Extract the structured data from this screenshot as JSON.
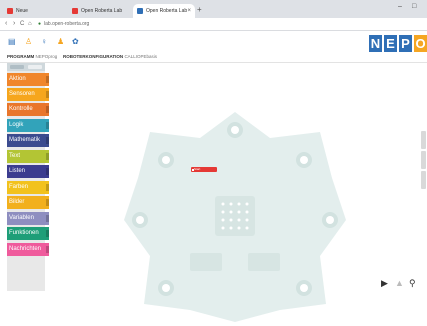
{
  "browser": {
    "tabs": [
      {
        "label": "Neue",
        "active": false
      },
      {
        "label": "Open Roberta Lab",
        "active": false
      },
      {
        "label": "Open Roberta Lab",
        "active": true
      }
    ],
    "new_tab": "+",
    "window_controls": [
      "–",
      "□"
    ],
    "nav": {
      "back": "‹",
      "forward": "›",
      "reload": "C",
      "home": "⌂"
    },
    "url": "lab.open-roberta.org"
  },
  "toolbar": {
    "icons": [
      "menu-icon",
      "robot-icon",
      "bulb-icon",
      "user-icon",
      "gear-icon"
    ]
  },
  "logo": {
    "letters": [
      "N",
      "E",
      "P",
      "O"
    ]
  },
  "program_bar": {
    "program_label": "PROGRAMM",
    "program_name": "NEPOprog",
    "config_label": "ROBOTERKONFIGURATION",
    "config_name": "CALLIOPEbasis"
  },
  "categories": [
    {
      "label": "Aktion",
      "color": "#f0862c"
    },
    {
      "label": "Sensoren",
      "color": "#f6a61d"
    },
    {
      "label": "Kontrolle",
      "color": "#e9762b"
    },
    {
      "label": "Logik",
      "color": "#32a3ba"
    },
    {
      "label": "Mathematik",
      "color": "#3b4b8f"
    },
    {
      "label": "Text",
      "color": "#b3c534"
    },
    {
      "label": "Listen",
      "color": "#3b3c8f"
    },
    {
      "label": "Farben",
      "color": "#f2c21d"
    },
    {
      "label": "Bilder",
      "color": "#f2b01d"
    },
    {
      "label": "Variablen",
      "color": "#8e8ec0"
    },
    {
      "label": "Funktionen",
      "color": "#1e9e78"
    },
    {
      "label": "Nachrichten",
      "color": "#ef5b9c"
    }
  ],
  "start_block": {
    "label": "Start",
    "color": "#e53935"
  },
  "bottom_controls": [
    "▶",
    "▲",
    "⚲"
  ]
}
